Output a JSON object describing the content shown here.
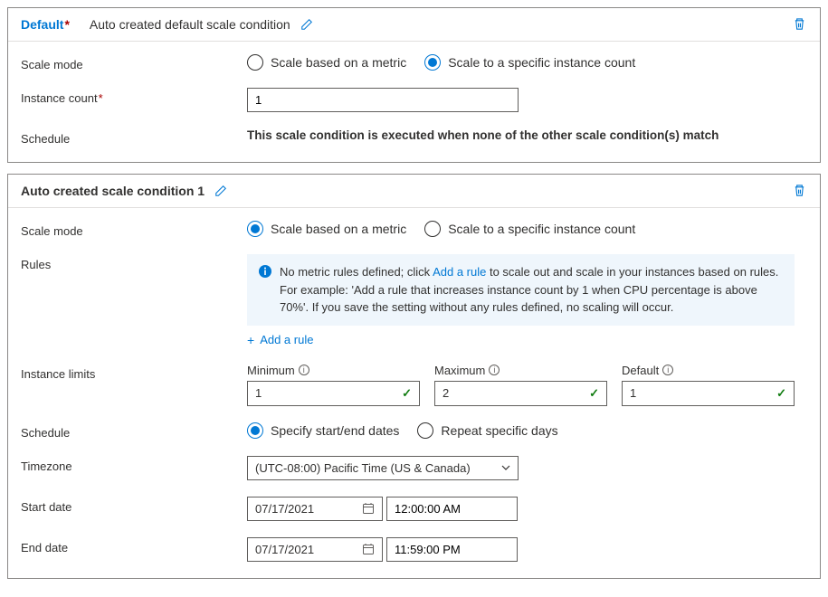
{
  "card1": {
    "title": "Default",
    "desc": "Auto created default scale condition",
    "scale_mode_label": "Scale mode",
    "option_metric": "Scale based on a metric",
    "option_specific": "Scale to a specific instance count",
    "instance_count_label": "Instance count",
    "instance_count_value": "1",
    "schedule_label": "Schedule",
    "schedule_text": "This scale condition is executed when none of the other scale condition(s) match"
  },
  "card2": {
    "title": "Auto created scale condition 1",
    "scale_mode_label": "Scale mode",
    "option_metric": "Scale based on a metric",
    "option_specific": "Scale to a specific instance count",
    "rules_label": "Rules",
    "info_text_pre": "No metric rules defined; click ",
    "info_link": "Add a rule",
    "info_text_post": " to scale out and scale in your instances based on rules. For example: 'Add a rule that increases instance count by 1 when CPU percentage is above 70%'. If you save the setting without any rules defined, no scaling will occur.",
    "add_rule": "Add a rule",
    "limits_label": "Instance limits",
    "min_label": "Minimum",
    "min_value": "1",
    "max_label": "Maximum",
    "max_value": "2",
    "default_label": "Default",
    "default_value": "1",
    "schedule_label": "Schedule",
    "option_dates": "Specify start/end dates",
    "option_repeat": "Repeat specific days",
    "timezone_label": "Timezone",
    "timezone_value": "(UTC-08:00) Pacific Time (US & Canada)",
    "start_date_label": "Start date",
    "start_date": "07/17/2021",
    "start_time": "12:00:00 AM",
    "end_date_label": "End date",
    "end_date": "07/17/2021",
    "end_time": "11:59:00 PM"
  }
}
